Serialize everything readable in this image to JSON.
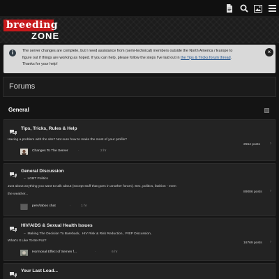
{
  "header": {
    "logo_top": "breeding",
    "logo_bottom": "ZONE"
  },
  "topbar": {
    "icons": [
      "document-icon",
      "search-icon",
      "image-icon",
      "menu-icon"
    ]
  },
  "notice": {
    "text_1": "The server changes are complete, but I need assistance from (semi-technical) members outside the North America / Europe to",
    "text_2": "figure out if things are working as hoped. If you can help, please follow the steps I've laid out in ",
    "link": "the Tips & Tricks forum thread",
    "text_2_end": ".",
    "text_3": "Thanks for your help!",
    "close": "×",
    "info": "i"
  },
  "page_title": "Forums",
  "category": {
    "title": "General"
  },
  "forums": [
    {
      "title": "Tips, Tricks, Rules & Help",
      "subforums": [],
      "description": "Having a problem with the site? Not sure how to make the most of your profile?",
      "description_2": "",
      "last_thread": "Changes To The Server",
      "last_time": "2 hr",
      "posts": "2554 posts",
      "end": "›"
    },
    {
      "title": "General Discussion",
      "subforums": [
        "LGBT Politics"
      ],
      "description": "Just about anything you want to talk about (except stuff that goes in another forum). Sex, politics, fashion - even",
      "description_2": "the weather...",
      "last_thread": "perv/taboo chat",
      "last_time": "1 hr",
      "posts": "89086 posts",
      "end": "›"
    },
    {
      "title": "HIV/AIDS & Sexual Health Issues",
      "subforums": [
        "Making The Decision To Bareback",
        "HIV Risk & Risk Reduction",
        "PrEP Discussion"
      ],
      "subforums_line2": "What's It Like To Be Poz?",
      "description": "",
      "description_2": "",
      "last_thread": "Hormonal Effect of Semen f...",
      "last_time": "6 hr",
      "posts": "16769 posts",
      "end": "›"
    },
    {
      "title": "Your Last Load...",
      "subforums": [],
      "description": "",
      "description_2": "",
      "last_thread": "",
      "last_time": "",
      "posts": "",
      "end": ""
    }
  ],
  "colors": {
    "background": "#141414",
    "logo_red": "#c7191b",
    "notice_bg": "#d9d9d9",
    "link": "#1a4f8c"
  }
}
